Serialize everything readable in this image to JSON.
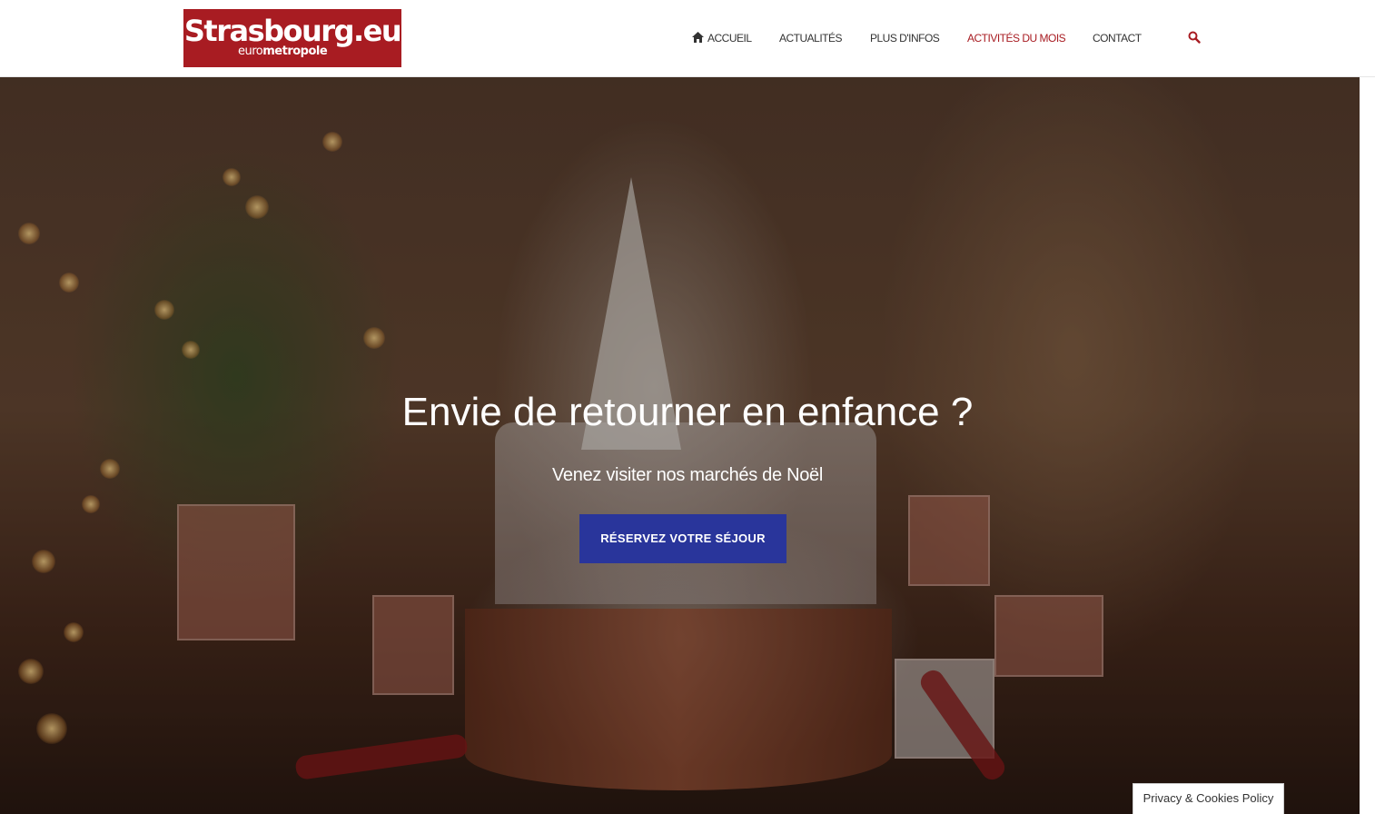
{
  "logo": {
    "main": "Strasbourg.eu",
    "sub_light": "euro",
    "sub_bold": "metropole"
  },
  "nav": {
    "items": [
      {
        "label": "ACCUEIL",
        "icon": "home-icon"
      },
      {
        "label": "ACTUALITÉS"
      },
      {
        "label": "PLUS D'INFOS"
      },
      {
        "label": "ACTIVITÉS DU MOIS",
        "active": true
      },
      {
        "label": "CONTACT"
      }
    ],
    "search_icon": "search-icon"
  },
  "hero": {
    "title": "Envie de retourner en enfance ?",
    "subtitle": "Venez visiter nos marchés de Noël",
    "cta_label": "RÉSERVEZ VOTRE SÉJOUR"
  },
  "privacy": {
    "label": "Privacy & Cookies Policy"
  },
  "colors": {
    "brand_red": "#a81c22",
    "cta_blue": "#29359b",
    "nav_text": "#333333"
  }
}
